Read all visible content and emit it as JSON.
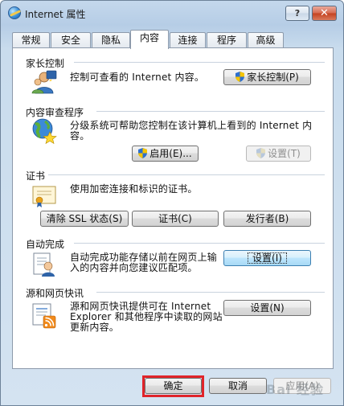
{
  "window": {
    "title": "Internet 属性",
    "help_label": "?",
    "close_label": "✕"
  },
  "tabs": [
    {
      "label": "常规"
    },
    {
      "label": "安全"
    },
    {
      "label": "隐私"
    },
    {
      "label": "内容"
    },
    {
      "label": "连接"
    },
    {
      "label": "程序"
    },
    {
      "label": "高级"
    }
  ],
  "active_tab": "内容",
  "sections": {
    "parental": {
      "title": "家长控制",
      "description": "控制可查看的 Internet 内容。",
      "button": "家长控制(P)"
    },
    "advisor": {
      "title": "内容审查程序",
      "description_line1": "分级系统可帮助您控制在该计算机上看到的 Internet 内",
      "description_line2": "容。",
      "enable_button": "启用(E)...",
      "settings_button": "设置(T)"
    },
    "certificates": {
      "title": "证书",
      "description": "使用加密连接和标识的证书。",
      "clear_ssl_button": "清除 SSL 状态(S)",
      "certificates_button": "证书(C)",
      "publishers_button": "发行者(B)"
    },
    "autocomplete": {
      "title": "自动完成",
      "description_line1": "自动完成功能存储以前在网页上输",
      "description_line2": "入的内容并向您建议匹配项。",
      "settings_button": "设置(I)"
    },
    "feeds": {
      "title": "源和网页快讯",
      "description_line1": "源和网页快讯提供可在 Internet",
      "description_line2": "Explorer 和其他程序中读取的网站",
      "description_line3": "更新内容。",
      "settings_button": "设置(N)"
    }
  },
  "footer": {
    "ok_button": "确定",
    "cancel_button": "取消",
    "apply_button": "应用(A)"
  },
  "watermark": "Bai 经验",
  "colors": {
    "highlight_border": "#e0242a",
    "focus_accent": "#3c7fb1"
  }
}
